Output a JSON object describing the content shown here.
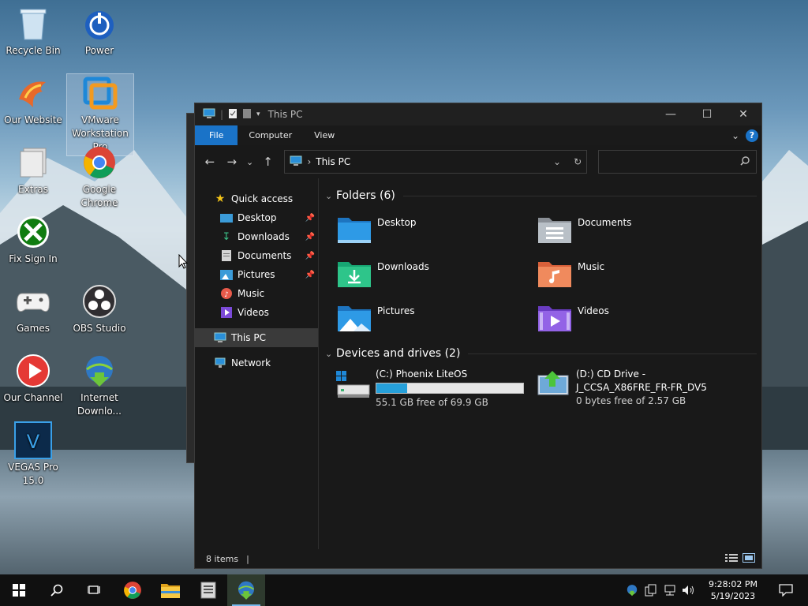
{
  "desktop": {
    "icons": [
      {
        "label": "Recycle Bin",
        "icon": "recycle-bin-icon"
      },
      {
        "label": "Power",
        "icon": "power-icon"
      },
      {
        "label": "Our Website",
        "icon": "phoenix-icon"
      },
      {
        "label": "VMware Workstation Pro",
        "icon": "vmware-icon"
      },
      {
        "label": "Extras",
        "icon": "folder-stack-icon"
      },
      {
        "label": "Google Chrome",
        "icon": "chrome-icon"
      },
      {
        "label": "Fix Sign In",
        "icon": "xbox-icon"
      },
      {
        "label": "Games",
        "icon": "gamepad-icon"
      },
      {
        "label": "OBS Studio",
        "icon": "obs-icon"
      },
      {
        "label": "Our Channel",
        "icon": "play-icon"
      },
      {
        "label": "Internet Downlo...",
        "icon": "idm-icon"
      },
      {
        "label": "VEGAS Pro 15.0",
        "icon": "vegas-icon"
      }
    ]
  },
  "explorer": {
    "title": "This PC",
    "ribbon": {
      "file": "File",
      "computer": "Computer",
      "view": "View",
      "help": "?"
    },
    "address": {
      "location": "This PC"
    },
    "search": {
      "placeholder": ""
    },
    "nav": {
      "quick_access": "Quick access",
      "items": [
        {
          "label": "Desktop",
          "pinned": true
        },
        {
          "label": "Downloads",
          "pinned": true
        },
        {
          "label": "Documents",
          "pinned": true
        },
        {
          "label": "Pictures",
          "pinned": true
        },
        {
          "label": "Music",
          "pinned": false
        },
        {
          "label": "Videos",
          "pinned": false
        }
      ],
      "this_pc": "This PC",
      "network": "Network"
    },
    "folders_header": "Folders (6)",
    "folders": [
      "Desktop",
      "Documents",
      "Downloads",
      "Music",
      "Pictures",
      "Videos"
    ],
    "drives_header": "Devices and drives (2)",
    "drives": [
      {
        "name": "(C:) Phoenix LiteOS",
        "free_text": "55.1 GB free of 69.9 GB",
        "used_fraction": 0.212
      },
      {
        "name_line1": "(D:) CD Drive -",
        "name_line2": "J_CCSA_X86FRE_FR-FR_DV5",
        "free_text": "0 bytes free of 2.57 GB"
      }
    ],
    "status": {
      "items": "8 items",
      "cursor": "|"
    }
  },
  "taskbar": {
    "time": "9:28:02 PM",
    "date": "5/19/2023"
  },
  "colors": {
    "accent": "#1a73c8",
    "drive_bar": "#26a0da"
  }
}
